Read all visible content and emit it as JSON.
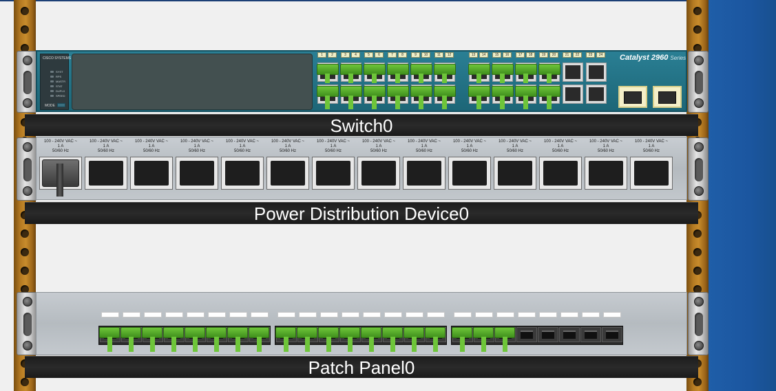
{
  "devices": {
    "switch": {
      "label": "Switch0",
      "vendor_text": "CISCO SYSTEMS",
      "model": "Catalyst 2960",
      "model_suffix": "Series",
      "leds": [
        "SYST",
        "RPS",
        "MASTR",
        "STAT",
        "DUPLX",
        "SPEED"
      ],
      "mode_label": "MODE",
      "port_numbers": [
        "1",
        "2",
        "3",
        "4",
        "5",
        "6",
        "7",
        "8",
        "9",
        "10",
        "11",
        "12",
        "13",
        "14",
        "15",
        "16",
        "17",
        "18",
        "19",
        "20",
        "21",
        "22",
        "23",
        "24"
      ],
      "gig_ports": [
        "1",
        "2"
      ],
      "connected_fastethernet_ports": 20
    },
    "power": {
      "label": "Power Distribution Device0",
      "outlet_line1": "100 - 240V VAC ~",
      "outlet_line2": "1 A",
      "outlet_line3": "50/60 Hz",
      "outlet_count": 14,
      "connected_outlets": 1
    },
    "patch_panel": {
      "label": "Patch Panel0",
      "port_count": 24,
      "connected_ports": 19
    }
  },
  "colors": {
    "rack_rail": "#b47a22",
    "switch_body": "#2a7f94",
    "cable_green": "#6ec53a",
    "label_bar": "#222222",
    "background": "#f0f0f0",
    "side_panel": "#1f5ea8"
  }
}
